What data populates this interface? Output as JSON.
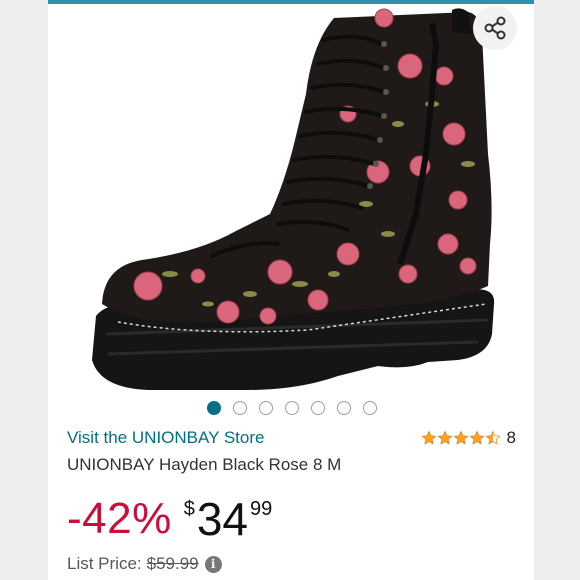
{
  "product": {
    "store_link": "Visit the UNIONBAY Store",
    "rating_count": "8",
    "rating_stars": 4.5,
    "title": "UNIONBAY Hayden Black Rose 8 M"
  },
  "carousel": {
    "image_count": 7,
    "active_index": 0
  },
  "price": {
    "discount": "-42%",
    "currency": "$",
    "whole": "34",
    "fraction": "99",
    "list_label": "List Price:",
    "list_value": "$59.99"
  },
  "icons": {
    "share": "share-icon",
    "info": "info-icon",
    "star": "star-icon"
  },
  "colors": {
    "link": "#007185",
    "discount": "#cc0c39",
    "star": "#ffa41c",
    "top_accent": "#2f8fae"
  }
}
